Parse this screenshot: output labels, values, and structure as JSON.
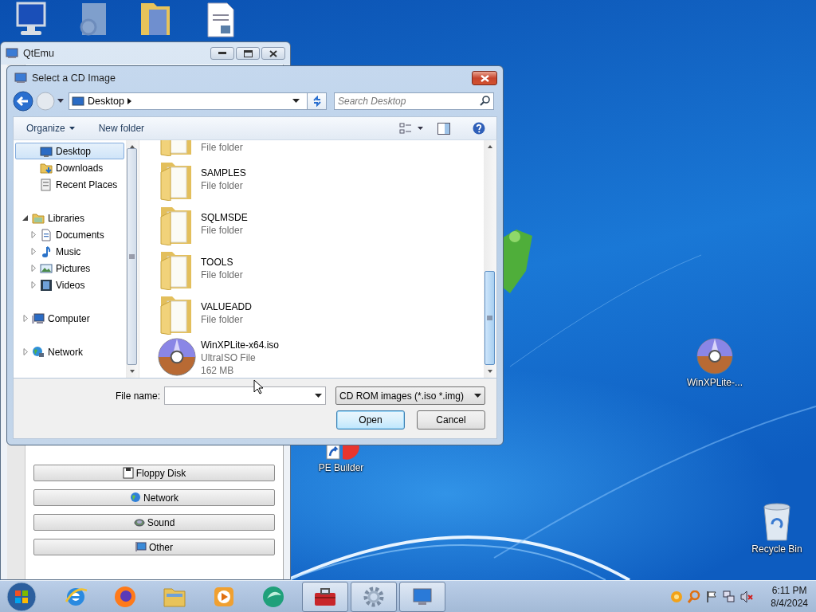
{
  "desktop": {
    "icons": [
      {
        "label": "PE Builder"
      },
      {
        "label": "WinXPLite-..."
      },
      {
        "label": "Recycle Bin"
      }
    ]
  },
  "qtemu": {
    "title": "QtEmu",
    "buttons": [
      "Floppy Disk",
      "Network",
      "Sound",
      "Other"
    ]
  },
  "dialog": {
    "title": "Select a CD Image",
    "address": "Desktop",
    "search": {
      "placeholder": "Search Desktop"
    },
    "toolbar": {
      "organize": "Organize",
      "new_folder": "New folder"
    },
    "nav": [
      {
        "label": "Desktop",
        "kind": "favorite",
        "selected": true
      },
      {
        "label": "Downloads",
        "kind": "favorite",
        "selected": false
      },
      {
        "label": "Recent Places",
        "kind": "favorite",
        "selected": false
      },
      {
        "label": "Libraries",
        "kind": "group",
        "selected": false,
        "expanded": true,
        "children": [
          {
            "label": "Documents",
            "selected": false,
            "expanded": false
          },
          {
            "label": "Music",
            "selected": false,
            "expanded": false
          },
          {
            "label": "Pictures",
            "selected": false,
            "expanded": false
          },
          {
            "label": "Videos",
            "selected": false,
            "expanded": false
          }
        ]
      },
      {
        "label": "Computer",
        "kind": "group",
        "selected": false,
        "expanded": false
      },
      {
        "label": "Network",
        "kind": "group",
        "selected": false,
        "expanded": false
      }
    ],
    "files": [
      {
        "kind": "folder",
        "type": "File folder"
      },
      {
        "kind": "folder",
        "name": "SAMPLES",
        "type": "File folder"
      },
      {
        "kind": "folder",
        "name": "SQLMSDE",
        "type": "File folder"
      },
      {
        "kind": "folder",
        "name": "TOOLS",
        "type": "File folder"
      },
      {
        "kind": "folder",
        "name": "VALUEADD",
        "type": "File folder"
      },
      {
        "kind": "disc",
        "name": "WinXPLite-x64.iso",
        "type": "UltraISO File",
        "size": "162 MB"
      }
    ],
    "file_name": {
      "label": "File name:"
    },
    "file_type": "CD ROM images (*.iso *.img)",
    "buttons": [
      {
        "label": "Open",
        "default": true
      },
      {
        "label": "Cancel",
        "default": false
      }
    ]
  },
  "taskbar": {
    "clock": {
      "time": "6:11 PM",
      "date": "8/4/2024"
    }
  }
}
